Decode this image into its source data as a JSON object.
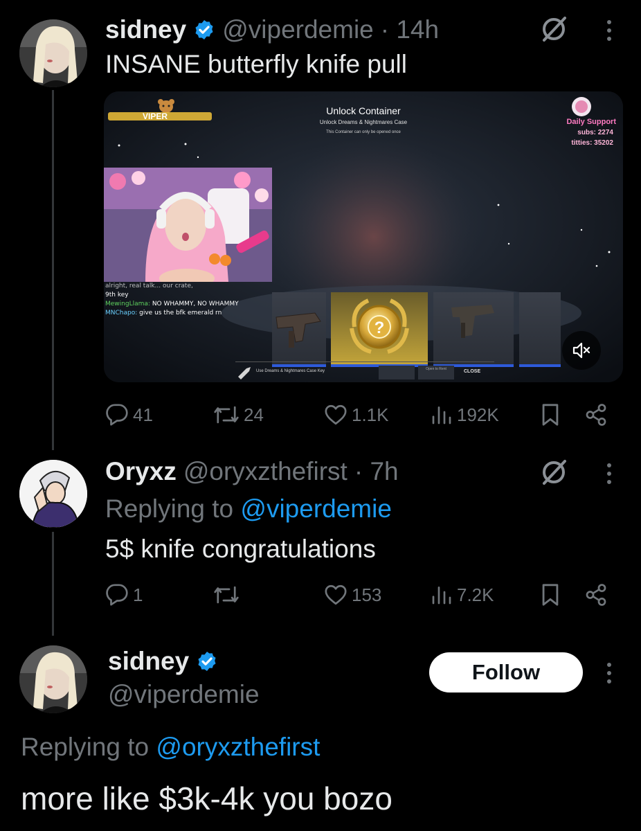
{
  "tweet1": {
    "display_name": "sidney",
    "handle": "@viperdemie",
    "time": "· 14h",
    "text": "INSANE butterfly knife pull",
    "stats": {
      "replies": "41",
      "reposts": "24",
      "likes": "1.1K",
      "views": "192K"
    },
    "media": {
      "overlay_logo_text": "VIPER",
      "container_title": "Unlock Container",
      "container_subtitle": "Unlock Dreams & Nightmares Case",
      "container_note": "This Container can only be opened once",
      "support_title": "Daily Support",
      "support_subs": "subs: 2274",
      "support_titties": "titties: 35202",
      "chat": [
        {
          "user": "",
          "text": "alright, real talk... our crate,"
        },
        {
          "user": "",
          "text": "9th key"
        },
        {
          "user": "MewingLlama:",
          "text": "NO WHAMMY, NO WHAMMY"
        },
        {
          "user": "MNChapo:",
          "text": "give us the bfk emerald rn"
        }
      ],
      "use_key_label": "Use Dreams & Nightmares Case Key",
      "open_button": "Open to Rent",
      "close_button": "CLOSE"
    }
  },
  "tweet2": {
    "display_name": "Oryxz",
    "handle": "@oryxzthefirst",
    "time": "· 7h",
    "replying_prefix": "Replying to",
    "replying_handle": "@viperdemie",
    "text": "5$ knife congratulations",
    "stats": {
      "replies": "1",
      "reposts": "",
      "likes": "153",
      "views": "7.2K"
    }
  },
  "tweet3": {
    "display_name": "sidney",
    "handle": "@viperdemie",
    "follow_label": "Follow",
    "replying_prefix": "Replying to",
    "replying_handle": "@oryxzthefirst",
    "text": "more like $3k-4k you bozo"
  },
  "colors": {
    "background": "#000000",
    "link_blue": "#1d9bf0",
    "muted": "#71767b",
    "text": "#e7e9ea",
    "verified": "#1d9bf0"
  },
  "icons": [
    "verified-icon",
    "grok-icon",
    "more-icon",
    "reply-icon",
    "repost-icon",
    "like-icon",
    "views-icon",
    "bookmark-icon",
    "share-icon",
    "mute-icon"
  ]
}
